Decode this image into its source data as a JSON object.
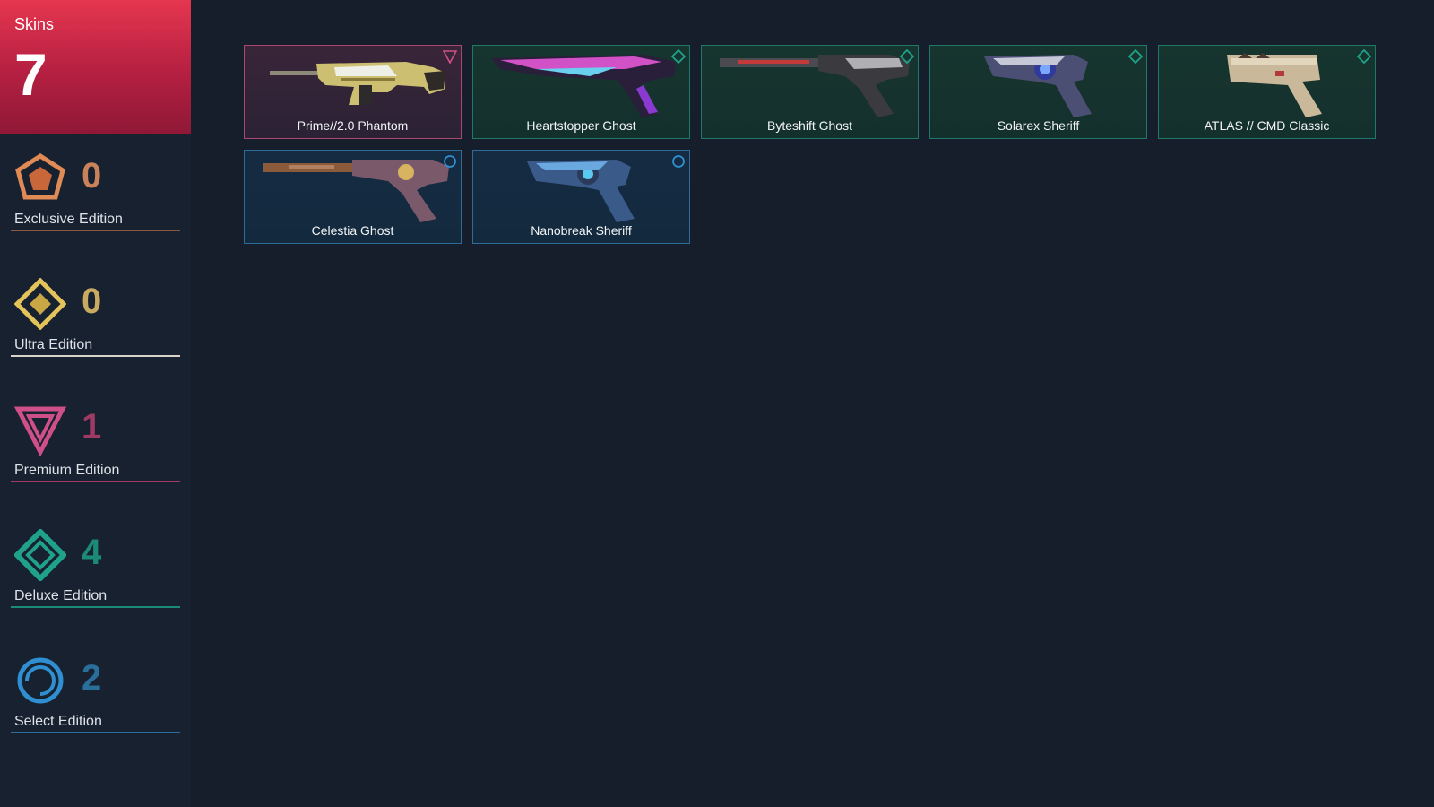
{
  "summary": {
    "label": "Skins",
    "total": "7"
  },
  "tiers": [
    {
      "name": "Exclusive Edition",
      "count": "0",
      "icon": "exclusive-edition-icon",
      "color": "#e08a55"
    },
    {
      "name": "Ultra Edition",
      "count": "0",
      "icon": "ultra-edition-icon",
      "color": "#e3c35a"
    },
    {
      "name": "Premium Edition",
      "count": "1",
      "icon": "premium-edition-icon",
      "color": "#cf4f88"
    },
    {
      "name": "Deluxe Edition",
      "count": "4",
      "icon": "deluxe-edition-icon",
      "color": "#1fa18a"
    },
    {
      "name": "Select Edition",
      "count": "2",
      "icon": "select-edition-icon",
      "color": "#2f8fd0"
    }
  ],
  "skins": [
    {
      "name": "Prime//2.0 Phantom",
      "tier": "premium"
    },
    {
      "name": "Heartstopper Ghost",
      "tier": "deluxe"
    },
    {
      "name": "Byteshift Ghost",
      "tier": "deluxe"
    },
    {
      "name": "Solarex Sheriff",
      "tier": "deluxe"
    },
    {
      "name": "ATLAS // CMD Classic",
      "tier": "deluxe"
    },
    {
      "name": "Celestia Ghost",
      "tier": "select"
    },
    {
      "name": "Nanobreak Sheriff",
      "tier": "select"
    }
  ]
}
